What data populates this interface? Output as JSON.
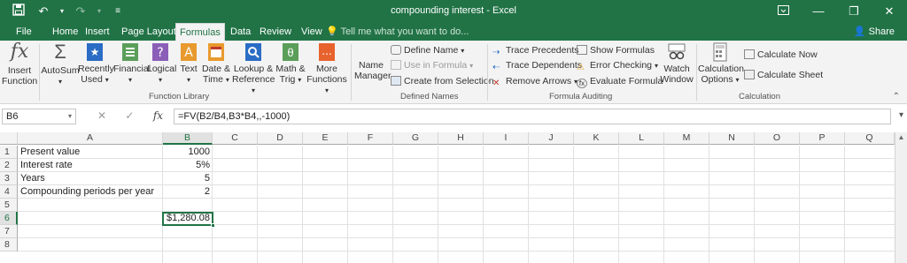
{
  "window": {
    "title": "compounding interest - Excel"
  },
  "tabs": [
    "File",
    "Home",
    "Insert",
    "Page Layout",
    "Formulas",
    "Data",
    "Review",
    "View"
  ],
  "active_tab": "Formulas",
  "tell_me": "Tell me what you want to do...",
  "share": "Share",
  "ribbon": {
    "insert_function": [
      "Insert",
      "Function"
    ],
    "function_library": {
      "autosum": "AutoSum",
      "recently_used": [
        "Recently",
        "Used"
      ],
      "financial": "Financial",
      "logical": "Logical",
      "text": "Text",
      "date_time": [
        "Date &",
        "Time"
      ],
      "lookup_reference": [
        "Lookup &",
        "Reference"
      ],
      "math_trig": [
        "Math &",
        "Trig"
      ],
      "more_functions": [
        "More",
        "Functions"
      ],
      "label": "Function Library"
    },
    "defined_names": {
      "name_manager": [
        "Name",
        "Manager"
      ],
      "define_name": "Define Name",
      "use_in_formula": "Use in Formula",
      "create_from_selection": "Create from Selection",
      "label": "Defined Names"
    },
    "formula_auditing": {
      "trace_precedents": "Trace Precedents",
      "trace_dependents": "Trace Dependents",
      "remove_arrows": "Remove Arrows",
      "show_formulas": "Show Formulas",
      "error_checking": "Error Checking",
      "evaluate_formula": "Evaluate Formula",
      "watch_window": [
        "Watch",
        "Window"
      ],
      "label": "Formula Auditing"
    },
    "calculation": {
      "calculation_options": [
        "Calculation",
        "Options"
      ],
      "calculate_now": "Calculate Now",
      "calculate_sheet": "Calculate Sheet",
      "label": "Calculation"
    }
  },
  "formula_bar": {
    "name_box": "B6",
    "formula": "=FV(B2/B4,B3*B4,,-1000)"
  },
  "columns": [
    "A",
    "B",
    "C",
    "D",
    "E",
    "F",
    "G",
    "H",
    "I",
    "J",
    "K",
    "L",
    "M",
    "N",
    "O",
    "P",
    "Q"
  ],
  "rows": [
    "1",
    "2",
    "3",
    "4",
    "5",
    "6",
    "7",
    "8"
  ],
  "cells": {
    "A1": "Present value",
    "B1": "1000",
    "A2": "Interest rate",
    "B2": "5%",
    "A3": "Years",
    "B3": "5",
    "A4": "Compounding periods per year",
    "B4": "2",
    "B6": "$1,280.08"
  },
  "colors": {
    "accent": "#217346"
  },
  "icons": [
    "save-icon",
    "undo-icon",
    "redo-icon",
    "customize-icon",
    "ribbon-display-icon",
    "minimize-icon",
    "restore-icon",
    "close-icon",
    "person-icon",
    "lightbulb-icon"
  ]
}
